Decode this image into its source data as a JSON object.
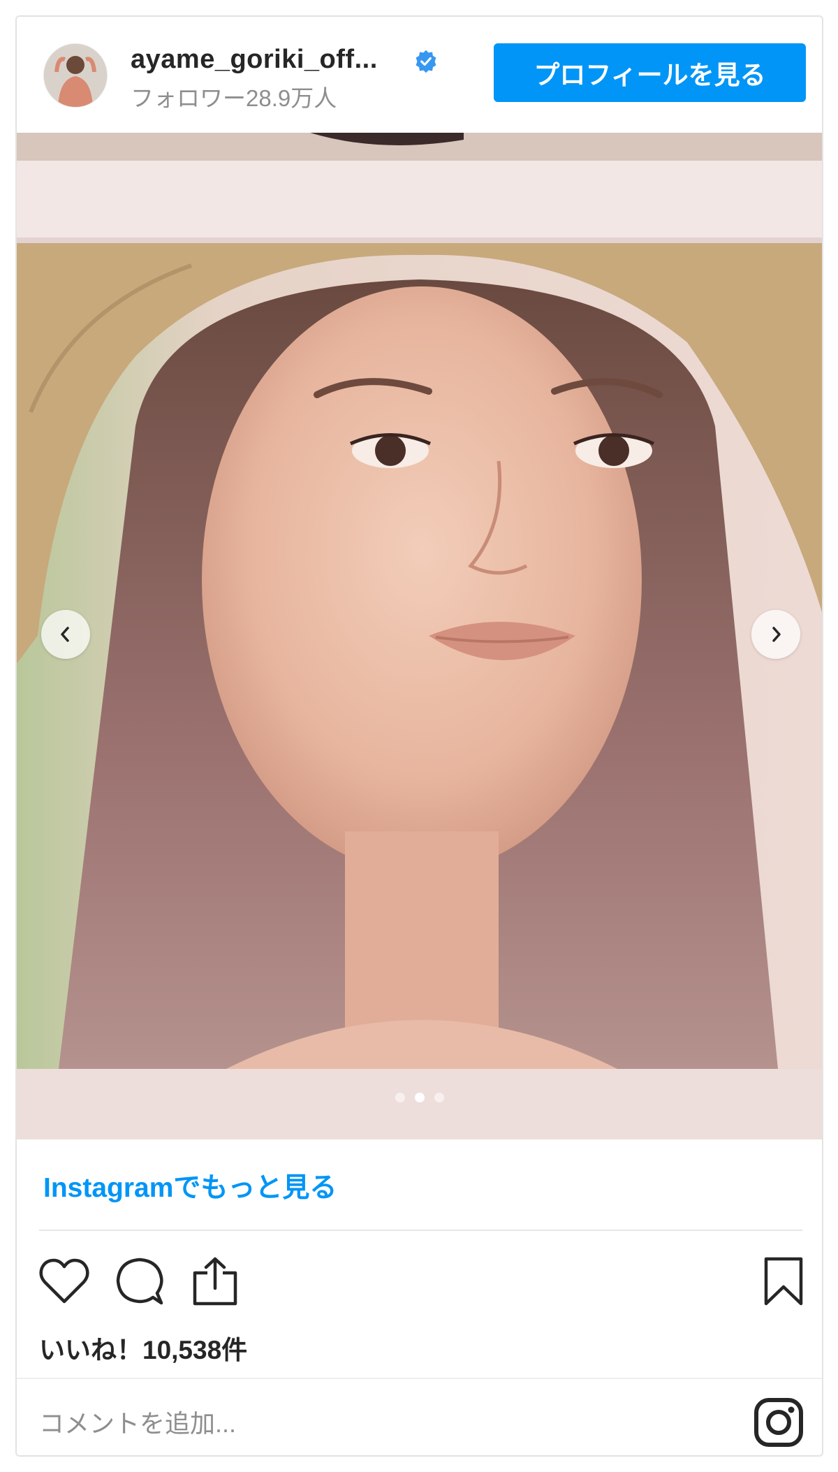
{
  "post": {
    "username": "ayame_goriki_off...",
    "followers": "フォロワー28.9万人",
    "profile_button": "プロフィールを見る",
    "more_link": "Instagramでもっと見る",
    "likes": "いいね！10,538件",
    "comment_placeholder": "コメントを追加..."
  },
  "carousel": {
    "slide_count": 3,
    "active_index": 1
  },
  "icons": {
    "verified": "verified-badge-icon",
    "prev": "chevron-left-icon",
    "next": "chevron-right-icon",
    "like": "heart-icon",
    "comment": "comment-icon",
    "share": "share-icon",
    "save": "bookmark-icon",
    "brand": "instagram-icon"
  },
  "colors": {
    "accent": "#0095f6",
    "text": "#262626",
    "muted": "#8e8e8e"
  }
}
